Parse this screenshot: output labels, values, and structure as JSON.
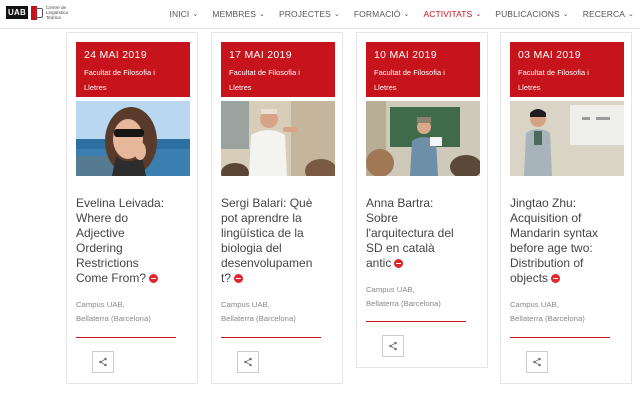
{
  "header": {
    "logo_badge": "UAB",
    "logo_text": "Centre de Lingüística Teòrica",
    "nav": [
      {
        "label": "INICI",
        "active": false
      },
      {
        "label": "MEMBRES",
        "active": false
      },
      {
        "label": "PROJECTES",
        "active": false
      },
      {
        "label": "FORMACIÓ",
        "active": false
      },
      {
        "label": "ACTIVITATS",
        "active": true
      },
      {
        "label": "PUBLICACIONS",
        "active": false
      },
      {
        "label": "RECERCA",
        "active": false
      }
    ]
  },
  "colors": {
    "accent": "#c7141c",
    "active_nav": "#c4121a",
    "dot": "#e0262d"
  },
  "cards": [
    {
      "date": "24 MAI 2019",
      "place_line1": "Facultat de Filosofia i",
      "place_line2": "Lletres",
      "title_lines": [
        "Evelina Leivada:",
        "Where do",
        "Adjective",
        "Ordering",
        "Restrictions",
        "Come From?"
      ],
      "location_line1": "Campus UAB,",
      "location_line2": "Bellaterra (Barcelona)",
      "share_icon": "share-icon"
    },
    {
      "date": "17 MAI 2019",
      "place_line1": "Facultat de Filosofia i",
      "place_line2": "Lletres",
      "title_lines": [
        "Sergi Balari: Què",
        "pot aprendre la",
        "lingüística de la",
        "biologia del",
        "desenvolupamen",
        "t?"
      ],
      "location_line1": "Campus UAB,",
      "location_line2": "Bellaterra (Barcelona)",
      "share_icon": "share-icon"
    },
    {
      "date": "10 MAI 2019",
      "place_line1": "Facultat de Filosofia i",
      "place_line2": "Lletres",
      "title_lines": [
        "Anna Bartra:",
        "Sobre",
        "l'arquitectura del",
        "SD en català",
        "antic"
      ],
      "location_line1": "Campus UAB,",
      "location_line2": "Bellaterra (Barcelona)",
      "share_icon": "share-icon"
    },
    {
      "date": "03 MAI 2019",
      "place_line1": "Facultat de Filosofia i",
      "place_line2": "Lletres",
      "title_lines": [
        "Jingtao Zhu:",
        "Acquisition of",
        "Mandarin syntax",
        "before age two:",
        "Distribution of",
        "objects"
      ],
      "location_line1": "Campus UAB,",
      "location_line2": "Bellaterra (Barcelona)",
      "share_icon": "share-icon"
    }
  ]
}
